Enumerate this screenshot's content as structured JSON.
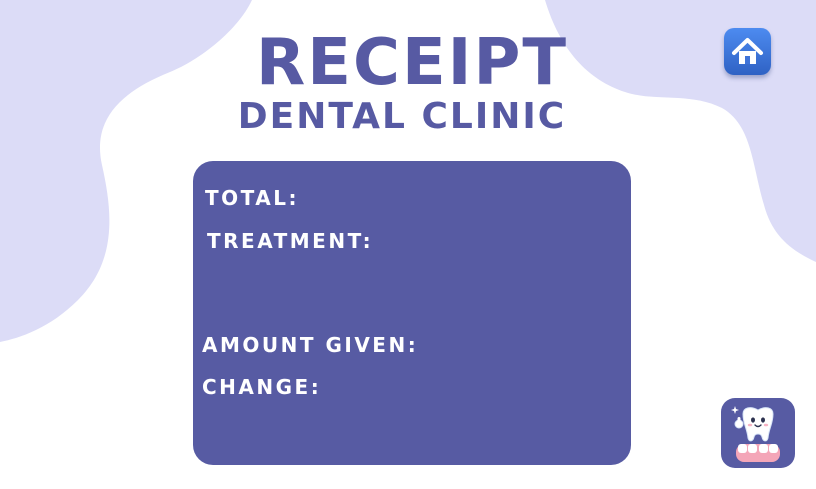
{
  "header": {
    "title": "RECEIPT",
    "subtitle": "DENTAL CLINIC"
  },
  "receipt": {
    "total_label": "TOTAL:",
    "treatment_label": "TREATMENT:",
    "amount_given_label": "AMOUNT GIVEN:",
    "change_label": "CHANGE:"
  },
  "icons": {
    "home": "home-icon",
    "mascot": "tooth-mascot-icon"
  },
  "colors": {
    "primary": "#575ba3",
    "background_blob": "#dcdcf7",
    "home_button": "#3f73d8",
    "text_on_card": "#ffffff"
  }
}
